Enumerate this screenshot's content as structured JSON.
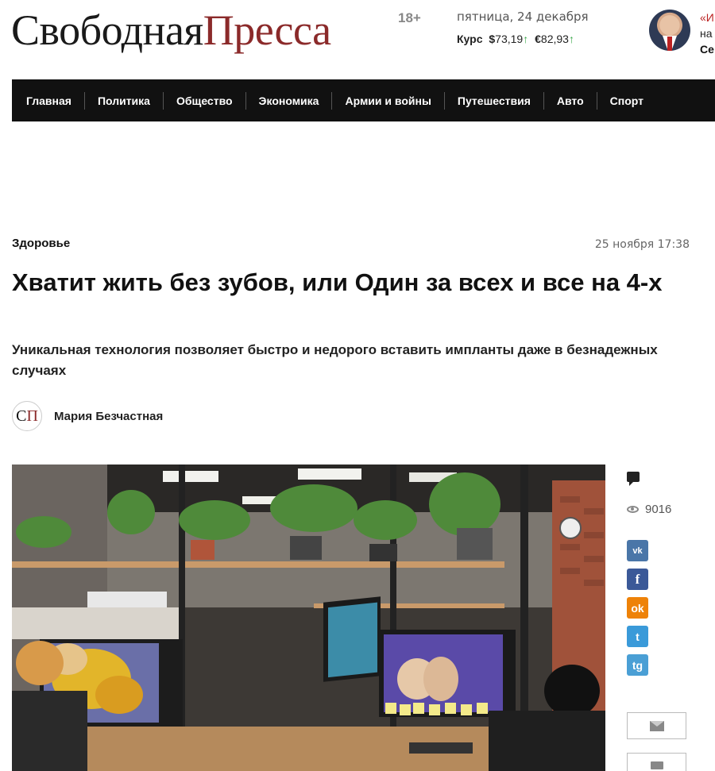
{
  "header": {
    "logo_part1": "Свободная",
    "logo_part2": "Пресса",
    "age_rating": "18+",
    "date": "пятница, 24 декабря",
    "rates_label": "Курс",
    "usd_symbol": "$",
    "usd_value": "73,19",
    "eur_symbol": "€",
    "eur_value": "82,93",
    "trend_arrow": "↑",
    "quote_mark": "«И",
    "quote_line2": "на",
    "quote_author": "Се"
  },
  "nav": {
    "items": [
      "Главная",
      "Политика",
      "Общество",
      "Экономика",
      "Армии и войны",
      "Путешествия",
      "Авто",
      "Спорт"
    ]
  },
  "article": {
    "rubric": "Здоровье",
    "date": "25 ноября 17:38",
    "title": "Хватит жить без зубов, или Один за всех и все на 4-х",
    "lead": "Уникальная технология позволяет быстро и недорого вставить импланты даже в безнадежных случаях",
    "author_mark_1": "С",
    "author_mark_2": "П",
    "author": "Мария Безчастная",
    "views": "9016"
  },
  "social": {
    "vk": "vk",
    "fb": "f",
    "ok": "ok",
    "tw": "t",
    "tg": "tg"
  },
  "colors": {
    "brand_red": "#8b2a2a",
    "nav_bg": "#111111",
    "rate_up": "#3aa84a"
  }
}
